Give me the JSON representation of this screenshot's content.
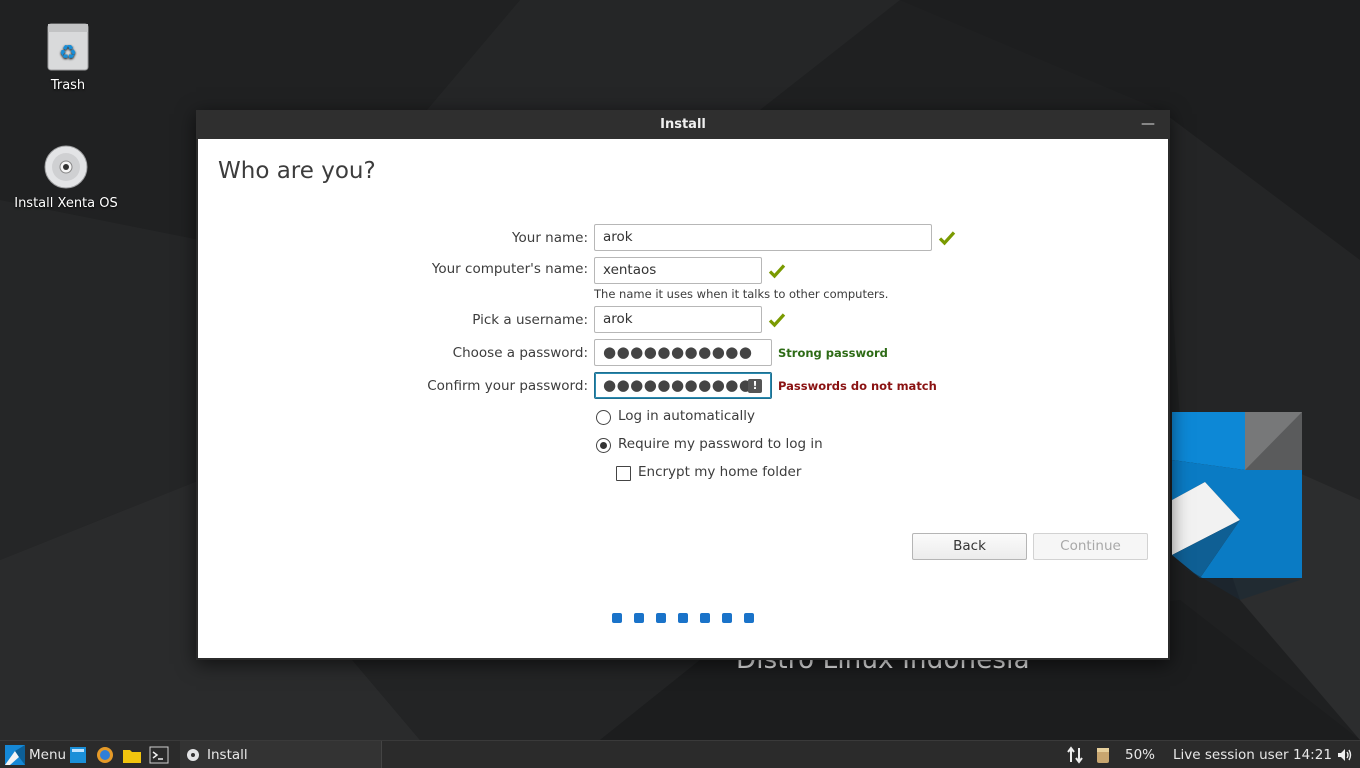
{
  "desktop": {
    "icons": [
      {
        "label": "Trash",
        "icon": "trash-icon"
      },
      {
        "label": "Install Xenta OS",
        "icon": "disc-icon"
      }
    ],
    "wallpaper_text": "Distro Linux Indonesia",
    "accent_color": "#1588d6"
  },
  "window": {
    "title": "Install",
    "minimize_symbol": "—",
    "page_title": "Who are you?",
    "fields": {
      "name": {
        "label": "Your name:",
        "value": "arok",
        "valid": true
      },
      "computer": {
        "label": "Your computer's name:",
        "value": "xentaos",
        "valid": true,
        "hint": "The name it uses when it talks to other computers."
      },
      "username": {
        "label": "Pick a username:",
        "value": "arok",
        "valid": true
      },
      "password": {
        "label": "Choose a password:",
        "value": "●●●●●●●●●●●",
        "strength": "Strong password"
      },
      "confirm": {
        "label": "Confirm your password:",
        "value": "●●●●●●●●●●●",
        "error": "Passwords do not match",
        "warning_symbol": "!"
      }
    },
    "login_options": {
      "auto": {
        "label": "Log in automatically",
        "selected": false
      },
      "require": {
        "label": "Require my password to log in",
        "selected": true
      },
      "encrypt": {
        "label": "Encrypt my home folder",
        "checked": false
      }
    },
    "buttons": {
      "back": "Back",
      "continue": "Continue"
    },
    "progress": {
      "steps": 7
    },
    "colors": {
      "valid_check": "#7a9a01",
      "strong": "#2d6b15",
      "error": "#8a1212",
      "progress": "#1a73c9"
    }
  },
  "taskbar": {
    "menu_label": "Menu",
    "launchers": [
      "file-manager-icon",
      "browser-icon",
      "folder-icon",
      "terminal-icon"
    ],
    "window_button": "Install",
    "volume_percent": "50%",
    "user": "Live session user",
    "clock": "14:21"
  }
}
